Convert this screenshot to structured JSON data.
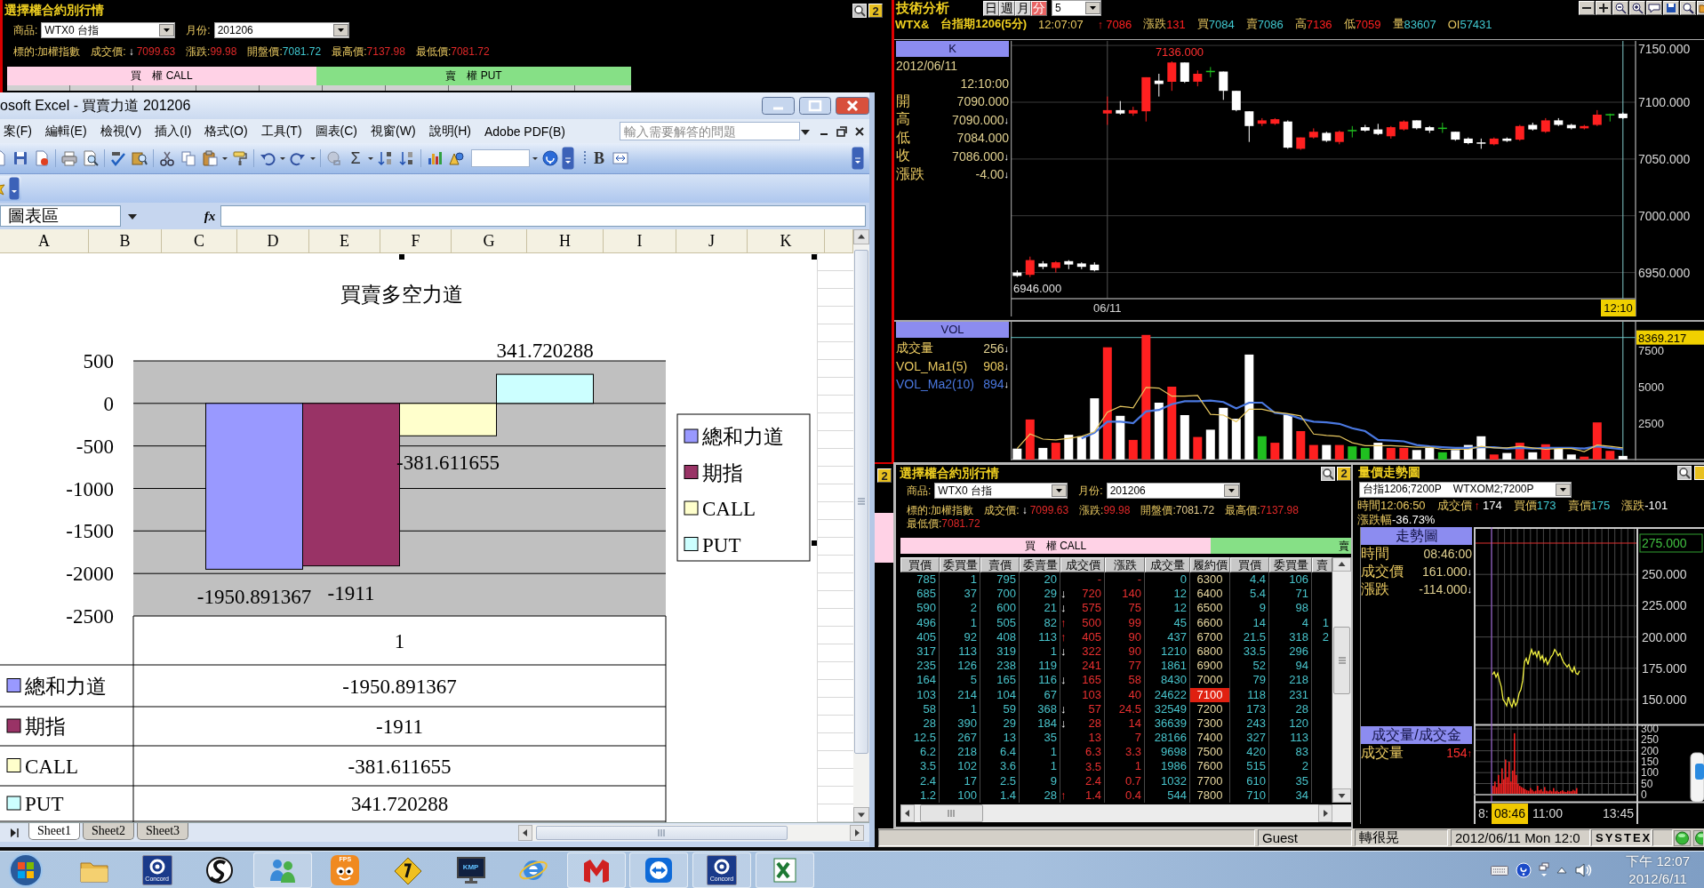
{
  "top_panel": {
    "title": "選擇權合約別行情",
    "help_badge": "2",
    "product_label": "商品:",
    "product_value": "WTX0 台指",
    "month_label": "月份:",
    "month_value": "201206",
    "quote": [
      {
        "label": "標的:",
        "value": "加權指數",
        "color": "#e8c860"
      },
      {
        "label": "成交價:",
        "arrow": "↓",
        "arrow_up": false,
        "value": "7099.63",
        "color": "#e02828"
      },
      {
        "label": "漲跌:",
        "value": "99.98",
        "color": "#e02828"
      },
      {
        "label": "開盤價:",
        "value": "7081.72",
        "color": "#40c8d0"
      },
      {
        "label": "最高價:",
        "value": "7137.98",
        "color": "#e02828"
      },
      {
        "label": "最低價:",
        "value": "7081.72",
        "color": "#e02828"
      }
    ],
    "sides": [
      {
        "label": "買　權 CALL",
        "kind": "call"
      },
      {
        "label": "賣　權 PUT",
        "kind": "put"
      }
    ]
  },
  "back_strip": {
    "help_badge": "2"
  },
  "excel": {
    "title": "osoft Excel - 買賣力道 201206",
    "menu": [
      "案(F)",
      "編輯(E)",
      "檢視(V)",
      "插入(I)",
      "格式(O)",
      "工具(T)",
      "圖表(C)",
      "視窗(W)",
      "說明(H)",
      "Adobe PDF(B)"
    ],
    "placeholder": "輸入需要解答的問題",
    "sum_label": "Σ",
    "bold_label": "B",
    "name_box": "圖表區",
    "fx_label": "fx",
    "columns": [
      "A",
      "B",
      "C",
      "D",
      "E",
      "F",
      "G",
      "H",
      "I",
      "J",
      "K"
    ],
    "chart": {
      "chart_data": {
        "type": "bar",
        "title": "買賣多空力道",
        "categories": [
          "1"
        ],
        "series": [
          {
            "name": "總和力道",
            "color": "#9999ff",
            "values": [
              -1950.891367
            ]
          },
          {
            "name": "期指",
            "color": "#993366",
            "values": [
              -1911
            ]
          },
          {
            "name": "CALL",
            "color": "#ffffcc",
            "values": [
              -381.611655
            ]
          },
          {
            "name": "PUT",
            "color": "#ccffff",
            "values": [
              341.720288
            ]
          }
        ],
        "ylim": [
          -2500,
          500
        ],
        "yticks": [
          500,
          0,
          -500,
          -1000,
          -1500,
          -2000,
          -2500
        ],
        "grid": true,
        "legend": "right",
        "data_labels": true
      },
      "data_table": [
        {
          "name": "總和力道",
          "value": "-1950.891367"
        },
        {
          "name": "期指",
          "value": "-1911"
        },
        {
          "name": "CALL",
          "value": "-381.611655"
        },
        {
          "name": "PUT",
          "value": "341.720288"
        }
      ]
    },
    "sheets": [
      {
        "label": "Sheet1",
        "selected": true
      },
      {
        "label": "Sheet2",
        "selected": false
      },
      {
        "label": "Sheet3",
        "selected": false
      }
    ]
  },
  "tech": {
    "title": "技術分析",
    "periods": [
      {
        "label": "日",
        "selected": false
      },
      {
        "label": "週",
        "selected": false
      },
      {
        "label": "月",
        "selected": false
      },
      {
        "label": "分",
        "selected": true
      }
    ],
    "interval": "5",
    "symbol": "WTX&",
    "contract": "台指期1206(5分)",
    "time": "12:07:07",
    "quote": [
      {
        "arrow": "↑",
        "arrow_up": true,
        "value": "7086",
        "color": "#ff2020"
      },
      {
        "label": "漲跌",
        "value": "131",
        "color": "#ff2020"
      },
      {
        "label": "買",
        "value": "7084",
        "color": "#40c8d0"
      },
      {
        "label": "賣",
        "value": "7086",
        "color": "#40c8d0"
      },
      {
        "label": "高",
        "value": "7136",
        "color": "#ff2020"
      },
      {
        "label": "低",
        "value": "7059",
        "color": "#ff2020"
      },
      {
        "label": "量",
        "value": "83607",
        "color": "#40c8d0"
      },
      {
        "label": "OI",
        "value": "57431",
        "color": "#40c8d0"
      }
    ],
    "info_header": "K",
    "date": "2012/06/11",
    "clock": "12:10:00",
    "ohlc": [
      {
        "label": "開",
        "value": "7090.000"
      },
      {
        "label": "高",
        "value": "7090.000",
        "arrow": "↓",
        "arrow_up": false
      },
      {
        "label": "低",
        "value": "7084.000"
      },
      {
        "label": "收",
        "value": "7086.000",
        "arrow": "↓",
        "arrow_up": false
      },
      {
        "label": "漲跌",
        "value": "-4.00",
        "arrow": "↓",
        "arrow_up": false
      }
    ],
    "high_label": "7136.000",
    "low_label": "6946.000",
    "cursor_time": "12:10",
    "price_chart": {
      "chart_data": {
        "type": "candlestick",
        "categories": [
          null,
          null,
          null,
          null,
          null,
          null,
          null,
          "06/11",
          null,
          null,
          null,
          null,
          null,
          null,
          null,
          null,
          null,
          null,
          null,
          null,
          null,
          null,
          null,
          null,
          null,
          null,
          null,
          null,
          null,
          null,
          null,
          null,
          null,
          null,
          null,
          null,
          null,
          null,
          null,
          null,
          null,
          null,
          null,
          null,
          null,
          null,
          null,
          null
        ],
        "ohlc": [
          [
            6950,
            6952,
            6946,
            6947
          ],
          [
            6948,
            6964,
            6946,
            6961
          ],
          [
            6958,
            6960,
            6953,
            6955
          ],
          [
            6954,
            6960,
            6950,
            6959
          ],
          [
            6960,
            6961,
            6953,
            6957
          ],
          [
            6958,
            6959,
            6953,
            6955
          ],
          [
            6957,
            6959,
            6951,
            6952
          ],
          [
            7090,
            7105,
            7080,
            7093
          ],
          [
            7093,
            7101,
            7089,
            7090
          ],
          [
            7090,
            7096,
            7088,
            7093
          ],
          [
            7092,
            7122,
            7083,
            7122
          ],
          [
            7119,
            7125,
            7105,
            7116
          ],
          [
            7118,
            7136,
            7110,
            7135
          ],
          [
            7135,
            7135,
            7117,
            7118
          ],
          [
            7118,
            7128,
            7114,
            7125
          ],
          [
            7127,
            7131,
            7122,
            7127
          ],
          [
            7127,
            7127,
            7102,
            7110
          ],
          [
            7110,
            7110,
            7092,
            7093
          ],
          [
            7092,
            7092,
            7065,
            7079
          ],
          [
            7081,
            7086,
            7079,
            7084
          ],
          [
            7081,
            7086,
            7080,
            7085
          ],
          [
            7083,
            7084,
            7059,
            7060
          ],
          [
            7059,
            7069,
            7058,
            7069
          ],
          [
            7069,
            7077,
            7068,
            7074
          ],
          [
            7073,
            7074,
            7065,
            7066
          ],
          [
            7065,
            7075,
            7063,
            7074
          ],
          [
            7075,
            7079,
            7069,
            7075
          ],
          [
            7078,
            7080,
            7074,
            7075
          ],
          [
            7076,
            7081,
            7071,
            7072
          ],
          [
            7070,
            7079,
            7068,
            7078
          ],
          [
            7076,
            7084,
            7075,
            7083
          ],
          [
            7084,
            7084,
            7076,
            7077
          ],
          [
            7078,
            7079,
            7073,
            7075
          ],
          [
            7077,
            7082,
            7073,
            7077
          ],
          [
            7074,
            7074,
            7066,
            7067
          ],
          [
            7068,
            7069,
            7063,
            7064
          ],
          [
            7064,
            7068,
            7059,
            7063
          ],
          [
            7063,
            7069,
            7062,
            7068
          ],
          [
            7068,
            7069,
            7065,
            7066
          ],
          [
            7067,
            7080,
            7066,
            7079
          ],
          [
            7080,
            7082,
            7075,
            7076
          ],
          [
            7074,
            7086,
            7073,
            7084
          ],
          [
            7084,
            7086,
            7079,
            7080
          ],
          [
            7080,
            7081,
            7076,
            7077
          ],
          [
            7077,
            7080,
            7076,
            7079
          ],
          [
            7080,
            7093,
            7079,
            7089
          ],
          [
            7089,
            7090,
            7083,
            7089
          ],
          [
            7090,
            7091,
            7085,
            7086
          ]
        ],
        "ylim": [
          6927,
          7154
        ],
        "yticks": [
          {
            "value": 7150,
            "label": "7150.000"
          },
          {
            "value": 7100,
            "label": "7100.000"
          },
          {
            "value": 7050,
            "label": "7050.000"
          },
          {
            "value": 7000,
            "label": "7000.000"
          },
          {
            "value": 6950,
            "label": "6950.000"
          }
        ],
        "grid": true
      }
    },
    "vol_header": "VOL",
    "vol_info": [
      {
        "value": "256",
        "arrow": "↓",
        "arrow_up": false
      },
      {
        "value": "908",
        "arrow": "↓",
        "arrow_up": false
      },
      {
        "value": "894",
        "arrow": "↓",
        "arrow_up": false
      }
    ],
    "vol_chart": {
      "chart_data": {
        "type": "bar",
        "categories": [
          null,
          null,
          null,
          null,
          null,
          null,
          null,
          null,
          null,
          null,
          null,
          null,
          null,
          null,
          null,
          null,
          null,
          null,
          null,
          null,
          null,
          null,
          null,
          null,
          null,
          null,
          null,
          null,
          null,
          null,
          null,
          null,
          null,
          null,
          null,
          null,
          null,
          null,
          null,
          null,
          null,
          null,
          null,
          null,
          null,
          null,
          null,
          null
        ],
        "series": [
          {
            "name": "成交量",
            "values": [
              750,
              2750,
              800,
              1150,
              1700,
              1600,
              4200,
              7700,
              3000,
              1350,
              8550,
              3900,
              5000,
              3050,
              1550,
              2050,
              3550,
              2800,
              7200,
              1600,
              1150,
              3100,
              1950,
              1000,
              1000,
              1000,
              900,
              800,
              1150,
              800,
              800,
              650,
              800,
              500,
              650,
              1000,
              1600,
              350,
              450,
              1150,
              500,
              1050,
              750,
              350,
              200,
              2550,
              600,
              250
            ],
            "colors": [
              "#ffffff",
              "#ff2020",
              "#ffffff",
              "#ff2020",
              "#ffffff",
              "#ffffff",
              "#ffffff",
              "#ff2020",
              "#ffffff",
              "#ff2020",
              "#ff2020",
              "#ffffff",
              "#ff2020",
              "#ffffff",
              "#ff2020",
              "#ffffff",
              "#ffffff",
              "#ffffff",
              "#ffffff",
              "#20c020",
              "#ff2020",
              "#ffffff",
              "#ff2020",
              "#ff2020",
              "#ffffff",
              "#ff2020",
              "#20c020",
              "#20c020",
              "#ffffff",
              "#ff2020",
              "#ff2020",
              "#ffffff",
              "#ffffff",
              "#20c020",
              "#ffffff",
              "#ffffff",
              "#ffffff",
              "#ff2020",
              "#ffffff",
              "#ff2020",
              "#ffffff",
              "#ff2020",
              "#ffffff",
              "#ffffff",
              "#ff2020",
              "#ff2020",
              "#ff2020",
              "#ffffff"
            ]
          },
          {
            "name": "VOL_Ma1(5)",
            "type": "line",
            "color": "#e8c860",
            "values": [
              750,
              1750,
              1400,
              1350,
              1450,
              1600,
              1900,
              3250,
              3650,
              3550,
              4950,
              4900,
              4350,
              4350,
              4400,
              3100,
              3050,
              2600,
              3450,
              3450,
              3250,
              3150,
              3000,
              1750,
              1650,
              1600,
              1150,
              950,
              950,
              950,
              900,
              850,
              850,
              700,
              700,
              700,
              900,
              800,
              800,
              900,
              800,
              700,
              750,
              750,
              550,
              1000,
              900,
              800
            ]
          },
          {
            "name": "VOL_Ma2(10)",
            "type": "line",
            "color": "#4a78e0",
            "values": [
              null,
              null,
              null,
              null,
              null,
              1450,
              1850,
              2600,
              2600,
              2500,
              3300,
              3400,
              3800,
              4000,
              4000,
              4050,
              3950,
              3500,
              3900,
              3900,
              3200,
              3100,
              2800,
              2600,
              2550,
              2450,
              2150,
              1950,
              1350,
              1300,
              1250,
              1000,
              900,
              850,
              800,
              800,
              850,
              850,
              750,
              800,
              750,
              800,
              800,
              800,
              750,
              900,
              800,
              700
            ]
          }
        ],
        "ylim": [
          0,
          9450
        ],
        "yticks": [
          7500,
          5000,
          2500
        ],
        "ref_lines": [
          {
            "axis": "y",
            "value": 8369.217,
            "label": "8369.217"
          }
        ]
      }
    }
  },
  "chain": {
    "title": "選擇權合約別行情",
    "help_badge": "2",
    "product_label": "商品:",
    "product_value": "WTX0 台指",
    "month_label": "月份:",
    "month_value": "201206",
    "quote": [
      {
        "label": "標的:",
        "value": "加權指數",
        "color": "#e8c860"
      },
      {
        "label": "成交價:",
        "arrow": "↓",
        "arrow_up": false,
        "value": "7099.63",
        "color": "#e02828"
      },
      {
        "label": "漲跌:",
        "value": "99.98",
        "color": "#e02828"
      },
      {
        "label": "開盤價:",
        "value": "7081.72",
        "color": "#e8d090"
      },
      {
        "label": "最高價:",
        "value": "7137.98",
        "color": "#e02828"
      },
      {
        "label": "最低價:",
        "value": "7081.72",
        "color": "#e02828"
      }
    ],
    "sides": [
      {
        "label": "買　權 CALL",
        "kind": "call"
      },
      {
        "label": "賣",
        "kind": "put"
      }
    ],
    "columns": [
      "買價",
      "委買量",
      "賣價",
      "委賣量",
      "成交價",
      "漲跌",
      "成交量",
      "履約價",
      "買價",
      "委買量",
      "賣"
    ],
    "rows": [
      {
        "bid": "785",
        "bid_qty": "1",
        "ask": "795",
        "ask_qty": "20",
        "last": "-",
        "change": "-",
        "volume": "0",
        "strike": "6300",
        "put_bid": "4.4",
        "put_bid_qty": "106",
        "highlighted": false
      },
      {
        "bid": "685",
        "bid_qty": "37",
        "ask": "700",
        "ask_qty": "29",
        "arrow": "↓",
        "arrow_up": false,
        "last": "720",
        "change": "140",
        "volume": "12",
        "strike": "6400",
        "put_bid": "5.4",
        "put_bid_qty": "71",
        "highlighted": false
      },
      {
        "bid": "590",
        "bid_qty": "2",
        "ask": "600",
        "ask_qty": "21",
        "arrow": "↓",
        "arrow_up": false,
        "last": "575",
        "change": "75",
        "volume": "12",
        "strike": "6500",
        "put_bid": "9",
        "put_bid_qty": "98",
        "highlighted": false
      },
      {
        "bid": "496",
        "bid_qty": "1",
        "ask": "505",
        "ask_qty": "82",
        "arrow": "↑",
        "arrow_up": true,
        "last": "500",
        "change": "99",
        "volume": "45",
        "strike": "6600",
        "put_bid": "14",
        "put_bid_qty": "4",
        "column_11": "1",
        "highlighted": false
      },
      {
        "bid": "405",
        "bid_qty": "92",
        "ask": "408",
        "ask_qty": "113",
        "arrow": "↑",
        "arrow_up": true,
        "last": "405",
        "change": "90",
        "volume": "437",
        "strike": "6700",
        "put_bid": "21.5",
        "put_bid_qty": "318",
        "column_11": "2",
        "highlighted": false
      },
      {
        "bid": "317",
        "bid_qty": "113",
        "ask": "319",
        "ask_qty": "1",
        "arrow": "↓",
        "arrow_up": false,
        "last": "322",
        "change": "90",
        "volume": "1210",
        "strike": "6800",
        "put_bid": "33.5",
        "put_bid_qty": "296",
        "highlighted": false
      },
      {
        "bid": "235",
        "bid_qty": "126",
        "ask": "238",
        "ask_qty": "119",
        "last": "241",
        "change": "77",
        "volume": "1861",
        "strike": "6900",
        "put_bid": "52",
        "put_bid_qty": "94",
        "highlighted": false
      },
      {
        "bid": "164",
        "bid_qty": "5",
        "ask": "165",
        "ask_qty": "116",
        "arrow": "↓",
        "arrow_up": false,
        "last": "165",
        "change": "58",
        "volume": "8430",
        "strike": "7000",
        "put_bid": "79",
        "put_bid_qty": "218",
        "highlighted": false
      },
      {
        "bid": "103",
        "bid_qty": "214",
        "ask": "104",
        "ask_qty": "67",
        "last": "103",
        "change": "40",
        "volume": "24622",
        "strike": "7100",
        "put_bid": "118",
        "put_bid_qty": "231",
        "highlighted": true
      },
      {
        "bid": "58",
        "bid_qty": "1",
        "ask": "59",
        "ask_qty": "368",
        "arrow": "↓",
        "arrow_up": false,
        "last": "57",
        "change": "24.5",
        "volume": "32549",
        "strike": "7200",
        "put_bid": "173",
        "put_bid_qty": "28",
        "highlighted": false
      },
      {
        "bid": "28",
        "bid_qty": "390",
        "ask": "29",
        "ask_qty": "184",
        "arrow": "↓",
        "arrow_up": false,
        "last": "28",
        "change": "14",
        "volume": "36639",
        "strike": "7300",
        "put_bid": "243",
        "put_bid_qty": "120",
        "highlighted": false
      },
      {
        "bid": "12.5",
        "bid_qty": "267",
        "ask": "13",
        "ask_qty": "35",
        "last": "13",
        "change": "7",
        "volume": "28166",
        "strike": "7400",
        "put_bid": "327",
        "put_bid_qty": "113",
        "highlighted": false
      },
      {
        "bid": "6.2",
        "bid_qty": "218",
        "ask": "6.4",
        "ask_qty": "1",
        "last": "6.3",
        "change": "3.3",
        "volume": "9698",
        "strike": "7500",
        "put_bid": "420",
        "put_bid_qty": "83",
        "highlighted": false
      },
      {
        "bid": "3.5",
        "bid_qty": "102",
        "ask": "3.6",
        "ask_qty": "1",
        "last": "3.5",
        "change": "1",
        "volume": "1986",
        "strike": "7600",
        "put_bid": "515",
        "put_bid_qty": "2",
        "highlighted": false
      },
      {
        "bid": "2.4",
        "bid_qty": "17",
        "ask": "2.5",
        "ask_qty": "9",
        "last": "2.4",
        "change": "0.7",
        "volume": "1032",
        "strike": "7700",
        "put_bid": "610",
        "put_bid_qty": "35",
        "highlighted": false
      },
      {
        "bid": "1.2",
        "bid_qty": "100",
        "ask": "1.4",
        "ask_qty": "28",
        "arrow": "↑",
        "arrow_up": true,
        "last": "1.4",
        "change": "0.4",
        "volume": "544",
        "strike": "7800",
        "put_bid": "710",
        "put_bid_qty": "34",
        "highlighted": false
      }
    ]
  },
  "trend": {
    "title": "量價走勢圖",
    "contract": "台指1206;7200P    WTXOM2;7200P",
    "quote": [
      {
        "label": "時間",
        "value": "12:06:50",
        "color": "#e8c860"
      },
      {
        "label": "成交價",
        "arrow": "↑",
        "arrow_up": true,
        "value": "174",
        "color": "#ffffff"
      },
      {
        "label": "買價",
        "value": "173",
        "color": "#40c8d0"
      },
      {
        "label": "賣價",
        "value": "175",
        "color": "#40c8d0"
      },
      {
        "label": "漲跌",
        "value": "-101",
        "color": "#ffffff"
      },
      {
        "label": "漲跌幅",
        "value": "-36.73%",
        "color": "#ffffff"
      }
    ],
    "info_header": "走勢圖",
    "info": [
      {
        "label": "時間",
        "value": "08:46:00"
      },
      {
        "label": "成交價",
        "value": "161.000",
        "arrow": "↓",
        "arrow_up": false
      },
      {
        "label": "漲跌",
        "value": "-114.000",
        "arrow": "↓",
        "arrow_up": false
      }
    ],
    "price_axis": [
      "275.000",
      "250.000",
      "225.000",
      "200.000",
      "175.000",
      "150.000"
    ],
    "vol_header": "成交量/成交金",
    "vol_info": [
      {
        "label": "成交量",
        "value": "154",
        "arrow": "↑",
        "arrow_up": true,
        "color": "#ff3030"
      }
    ],
    "vol_axis": [
      "300",
      "250",
      "200",
      "150",
      "100",
      "50",
      "0"
    ],
    "time_axis": [
      {
        "label": "8:",
        "kind": "tick"
      },
      {
        "label": "08:46",
        "kind": "cursor"
      },
      {
        "label": "11:00",
        "kind": "tick"
      },
      {
        "label": "13:45",
        "kind": "tick"
      }
    ]
  },
  "status": {
    "cells": [
      "Guest",
      "轉很晃",
      "2012/06/11 Mon 12:0"
    ],
    "brand": "SYSTEX"
  },
  "taskbar": {
    "apps": [
      {
        "kind": "folder",
        "running": false
      },
      {
        "kind": "ring_logo",
        "caption": "Concord",
        "running": false
      },
      {
        "kind": "swirl",
        "running": false
      },
      {
        "kind": "people",
        "running": true
      },
      {
        "kind": "face",
        "caption": "FPS",
        "running": false
      },
      {
        "kind": "diamond",
        "running": false
      },
      {
        "kind": "monitor",
        "caption": "KMP",
        "running": false
      },
      {
        "kind": "globe",
        "running": false
      },
      {
        "kind": "arch",
        "running": true
      },
      {
        "kind": "arrows",
        "running": true
      },
      {
        "kind": "ring_logo",
        "caption": "Concord",
        "running": true
      },
      {
        "kind": "spreadsheet",
        "running": true
      }
    ],
    "clock_time": "下午 12:07",
    "clock_date": "2012/6/11"
  }
}
